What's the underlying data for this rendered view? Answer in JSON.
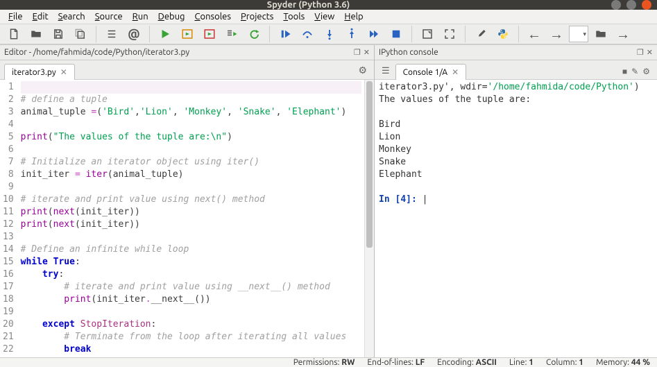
{
  "title": "Spyder (Python 3.6)",
  "menu": [
    "File",
    "Edit",
    "Search",
    "Source",
    "Run",
    "Debug",
    "Consoles",
    "Projects",
    "Tools",
    "View",
    "Help"
  ],
  "editor": {
    "header": "Editor - /home/fahmida/code/Python/iterator3.py",
    "tab_label": "iterator3.py",
    "lines": [
      {
        "n": 1,
        "raw": "",
        "hl": true
      },
      {
        "n": 2,
        "tokens": [
          {
            "t": "# define a tuple",
            "c": "cm-comment"
          }
        ]
      },
      {
        "n": 3,
        "tokens": [
          {
            "t": "animal_tuple "
          },
          {
            "t": "=",
            "c": "cm-op"
          },
          {
            "t": "("
          },
          {
            "t": "'Bird'",
            "c": "cm-str"
          },
          {
            "t": ","
          },
          {
            "t": "'Lion'",
            "c": "cm-str"
          },
          {
            "t": ", "
          },
          {
            "t": "'Monkey'",
            "c": "cm-str"
          },
          {
            "t": ", "
          },
          {
            "t": "'Snake'",
            "c": "cm-str"
          },
          {
            "t": ", "
          },
          {
            "t": "'Elephant'",
            "c": "cm-str"
          },
          {
            "t": ")"
          }
        ]
      },
      {
        "n": 4,
        "raw": ""
      },
      {
        "n": 5,
        "tokens": [
          {
            "t": "print",
            "c": "cm-builtin"
          },
          {
            "t": "("
          },
          {
            "t": "\"The values of the tuple are:\\n\"",
            "c": "cm-str"
          },
          {
            "t": ")"
          }
        ]
      },
      {
        "n": 6,
        "raw": ""
      },
      {
        "n": 7,
        "tokens": [
          {
            "t": "# Initialize an iterator object using iter()",
            "c": "cm-comment"
          }
        ]
      },
      {
        "n": 8,
        "tokens": [
          {
            "t": "init_iter "
          },
          {
            "t": "=",
            "c": "cm-op"
          },
          {
            "t": " "
          },
          {
            "t": "iter",
            "c": "cm-builtin"
          },
          {
            "t": "(animal_tuple)"
          }
        ]
      },
      {
        "n": 9,
        "raw": ""
      },
      {
        "n": 10,
        "tokens": [
          {
            "t": "# iterate and print value using next() method",
            "c": "cm-comment"
          }
        ]
      },
      {
        "n": 11,
        "tokens": [
          {
            "t": "print",
            "c": "cm-builtin"
          },
          {
            "t": "("
          },
          {
            "t": "next",
            "c": "cm-builtin"
          },
          {
            "t": "(init_iter))"
          }
        ]
      },
      {
        "n": 12,
        "tokens": [
          {
            "t": "print",
            "c": "cm-builtin"
          },
          {
            "t": "("
          },
          {
            "t": "next",
            "c": "cm-builtin"
          },
          {
            "t": "(init_iter))"
          }
        ]
      },
      {
        "n": 13,
        "raw": ""
      },
      {
        "n": 14,
        "tokens": [
          {
            "t": "# Define an infinite while loop",
            "c": "cm-comment"
          }
        ]
      },
      {
        "n": 15,
        "tokens": [
          {
            "t": "while ",
            "c": "cm-kw"
          },
          {
            "t": "True",
            "c": "cm-kw"
          },
          {
            "t": ":"
          }
        ]
      },
      {
        "n": 16,
        "tokens": [
          {
            "t": "    "
          },
          {
            "t": "try",
            "c": "cm-kw"
          },
          {
            "t": ":"
          }
        ]
      },
      {
        "n": 17,
        "tokens": [
          {
            "t": "        "
          },
          {
            "t": "# iterate and print value using __next__() method",
            "c": "cm-comment"
          }
        ]
      },
      {
        "n": 18,
        "tokens": [
          {
            "t": "        "
          },
          {
            "t": "print",
            "c": "cm-builtin"
          },
          {
            "t": "(init_iter"
          },
          {
            "t": ".",
            "c": "cm-op"
          },
          {
            "t": "__next__())"
          }
        ]
      },
      {
        "n": 19,
        "raw": ""
      },
      {
        "n": 20,
        "tokens": [
          {
            "t": "    "
          },
          {
            "t": "except ",
            "c": "cm-kw"
          },
          {
            "t": "StopIteration",
            "c": "cm-exc"
          },
          {
            "t": ":"
          }
        ]
      },
      {
        "n": 21,
        "tokens": [
          {
            "t": "        "
          },
          {
            "t": "# Terminate from the loop after iterating all values",
            "c": "cm-comment"
          }
        ]
      },
      {
        "n": 22,
        "tokens": [
          {
            "t": "        "
          },
          {
            "t": "break",
            "c": "cm-kw"
          }
        ]
      }
    ]
  },
  "console": {
    "header": "IPython console",
    "tab_label": "Console 1/A",
    "output_prefix": "iterator3.py'",
    "output_wdir_label": ", wdir=",
    "output_wdir_path": "'/home/fahmida/code/Python'",
    "output_suffix": ")",
    "line1": "The values of the tuple are:",
    "values": [
      "Bird",
      "Lion",
      "Monkey",
      "Snake",
      "Elephant"
    ],
    "prompt_in": "In [",
    "prompt_num": "4",
    "prompt_close": "]: "
  },
  "status": {
    "permissions_label": "Permissions:",
    "permissions_value": "RW",
    "eol_label": "End-of-lines:",
    "eol_value": "LF",
    "encoding_label": "Encoding:",
    "encoding_value": "ASCII",
    "line_label": "Line:",
    "line_value": "1",
    "column_label": "Column:",
    "column_value": "1",
    "memory_label": "Memory:",
    "memory_value": "44 %"
  }
}
